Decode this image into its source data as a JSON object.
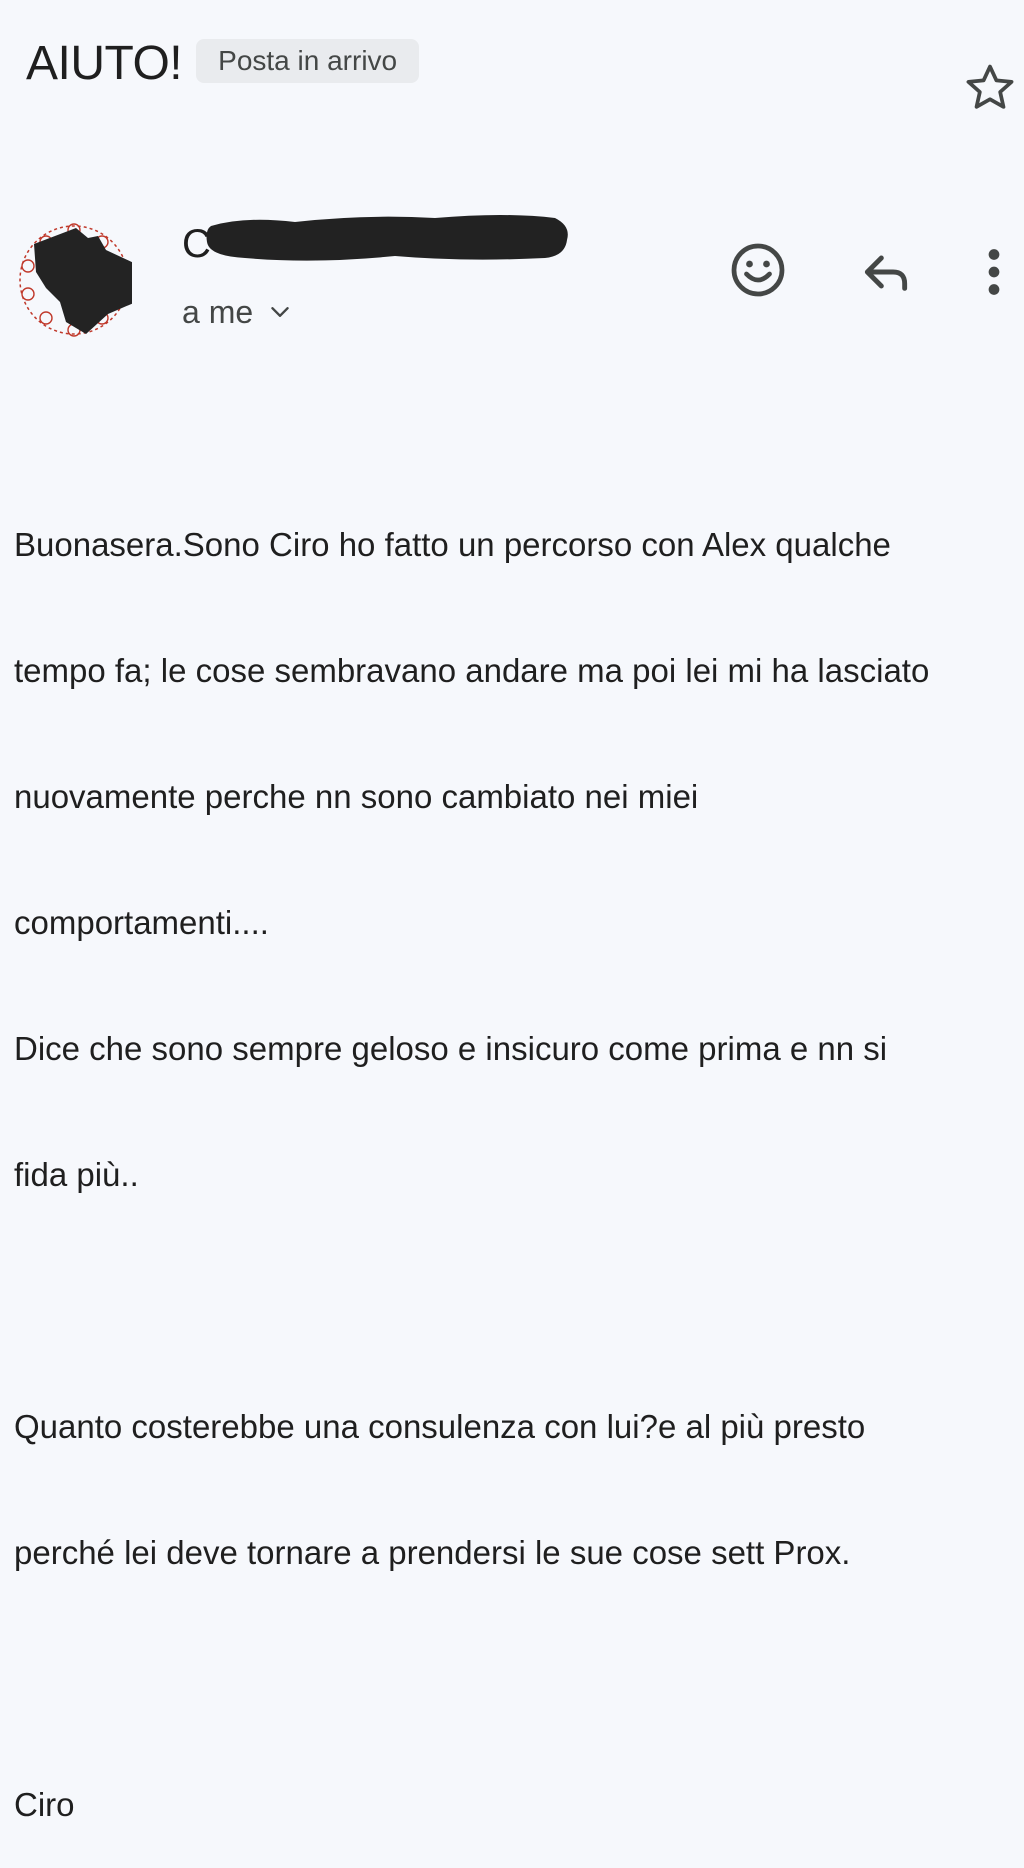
{
  "header": {
    "subject": "AIUTO!",
    "label": "Posta in arrivo",
    "star_icon": "star-outline-icon"
  },
  "sender": {
    "name_visible": "C",
    "redacted": true,
    "avatar_icon": "avatar-redacted",
    "recipient": "a me",
    "recipient_chevron_icon": "chevron-down-icon"
  },
  "actions": {
    "emoji_icon": "emoji-reaction-icon",
    "reply_icon": "reply-icon",
    "more_icon": "more-vert-icon"
  },
  "message": {
    "paragraph1_lines": [
      "Buonasera.Sono Ciro ho fatto un percorso con Alex qualche",
      "tempo fa; le cose sembravano andare ma poi lei mi ha lasciato",
      "nuovamente perche nn sono cambiato nei miei",
      "comportamenti....",
      "Dice che sono sempre geloso e insicuro come prima e nn si",
      "fida più.."
    ],
    "paragraph2_lines": [
      "Quanto costerebbe una consulenza con lui?e al più presto",
      "perché lei deve tornare a prendersi le sue cose sett Prox."
    ],
    "signature": "Ciro"
  },
  "colors": {
    "background": "#f6f8fc",
    "text": "#1f1f1f",
    "muted": "#444746",
    "chip": "#e9ebee",
    "avatar_ring": "#c0392b",
    "redaction": "#222222"
  }
}
